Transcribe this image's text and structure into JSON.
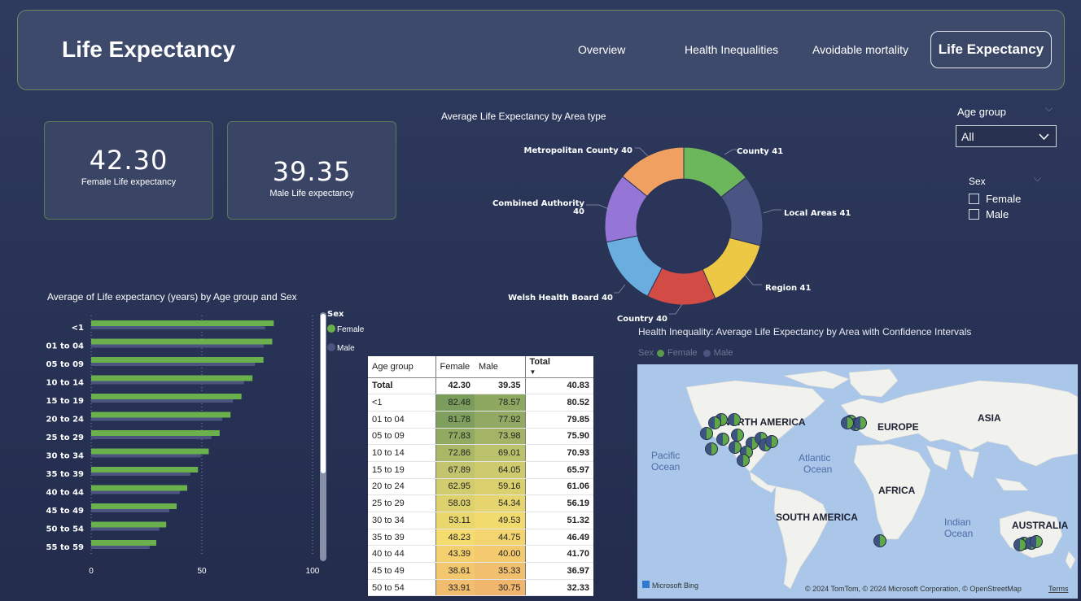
{
  "header": {
    "title": "Life Expectancy",
    "nav": [
      "Overview",
      "Health Inequalities",
      "Avoidable mortality",
      "Life Expectancy"
    ],
    "active": "Life Expectancy"
  },
  "kpis": {
    "female_value": "42.30",
    "female_label": "Female Life expectancy",
    "male_value": "39.35",
    "male_label": "Male Life expectancy"
  },
  "filters": {
    "age_group_title": "Age group",
    "age_group_value": "All",
    "sex_title": "Sex",
    "sex_options": [
      "Female",
      "Male"
    ]
  },
  "colors": {
    "female": "#6ab04c",
    "male": "#4b5580",
    "donut": [
      "#6cb65b",
      "#4a5583",
      "#ecc845",
      "#d24b45",
      "#6aaee0",
      "#9575d6",
      "#f0a060"
    ]
  },
  "chart_data": [
    {
      "type": "pie",
      "title": "Average Life Expectancy by Area type",
      "labels": [
        "County",
        "Local Areas",
        "Region",
        "Country",
        "Welsh Health Board",
        "Combined Authority",
        "Metropolitan County"
      ],
      "values": [
        41,
        41,
        41,
        40,
        40,
        40,
        40
      ],
      "value_labels": [
        "County 41",
        "Local Areas 41",
        "Region 41",
        "Country 40",
        "Welsh Health Board 40",
        "Combined Authority",
        "40",
        "Metropolitan County 40"
      ]
    },
    {
      "type": "bar",
      "title": "Average of Life expectancy (years) by Age group and Sex",
      "categories": [
        "<1",
        "01 to 04",
        "05 to 09",
        "10 to 14",
        "15 to 19",
        "20 to 24",
        "25 to 29",
        "30 to 34",
        "35 to 39",
        "40 to 44",
        "45 to 49",
        "50 to 54",
        "55 to 59"
      ],
      "series": [
        {
          "name": "Female",
          "values": [
            82.48,
            81.78,
            77.83,
            72.86,
            67.89,
            62.95,
            58.03,
            53.11,
            48.23,
            43.39,
            38.61,
            33.91,
            29.4
          ]
        },
        {
          "name": "Male",
          "values": [
            78.57,
            77.92,
            73.98,
            69.01,
            64.05,
            59.16,
            54.34,
            49.53,
            44.75,
            40.0,
            35.33,
            30.75,
            26.4
          ]
        }
      ],
      "legend_title": "Sex",
      "xlim": [
        0,
        100
      ],
      "xticks": [
        "0",
        "50",
        "100"
      ]
    },
    {
      "type": "table",
      "columns": [
        "Age group",
        "Female",
        "Male",
        "Total"
      ],
      "rows": [
        [
          "Total",
          "42.30",
          "39.35",
          "40.83"
        ],
        [
          "<1",
          "82.48",
          "78.57",
          "80.52"
        ],
        [
          "01 to 04",
          "81.78",
          "77.92",
          "79.85"
        ],
        [
          "05 to 09",
          "77.83",
          "73.98",
          "75.90"
        ],
        [
          "10 to 14",
          "72.86",
          "69.01",
          "70.93"
        ],
        [
          "15 to 19",
          "67.89",
          "64.05",
          "65.97"
        ],
        [
          "20 to 24",
          "62.95",
          "59.16",
          "61.06"
        ],
        [
          "25 to 29",
          "58.03",
          "54.34",
          "56.19"
        ],
        [
          "30 to 34",
          "53.11",
          "49.53",
          "51.32"
        ],
        [
          "35 to 39",
          "48.23",
          "44.75",
          "46.49"
        ],
        [
          "40 to 44",
          "43.39",
          "40.00",
          "41.70"
        ],
        [
          "45 to 49",
          "38.61",
          "35.33",
          "36.97"
        ],
        [
          "50 to 54",
          "33.91",
          "30.75",
          "32.33"
        ]
      ]
    }
  ],
  "map": {
    "title": "Health Inequality: Average Life Expectancy by Area with Confidence Intervals",
    "legend_title": "Sex",
    "legend": [
      "Female",
      "Male"
    ],
    "labels": [
      "NORTH AMERICA",
      "EUROPE",
      "ASIA",
      "AFRICA",
      "SOUTH AMERICA",
      "AUSTRALIA",
      "Pacific",
      "Ocean",
      "Atlantic",
      "Ocean",
      "Indian",
      "Ocean"
    ],
    "attribution": "© 2024 TomTom, © 2024 Microsoft Corporation, © OpenStreetMap",
    "terms": "Terms",
    "brand": "Microsoft Bing"
  }
}
